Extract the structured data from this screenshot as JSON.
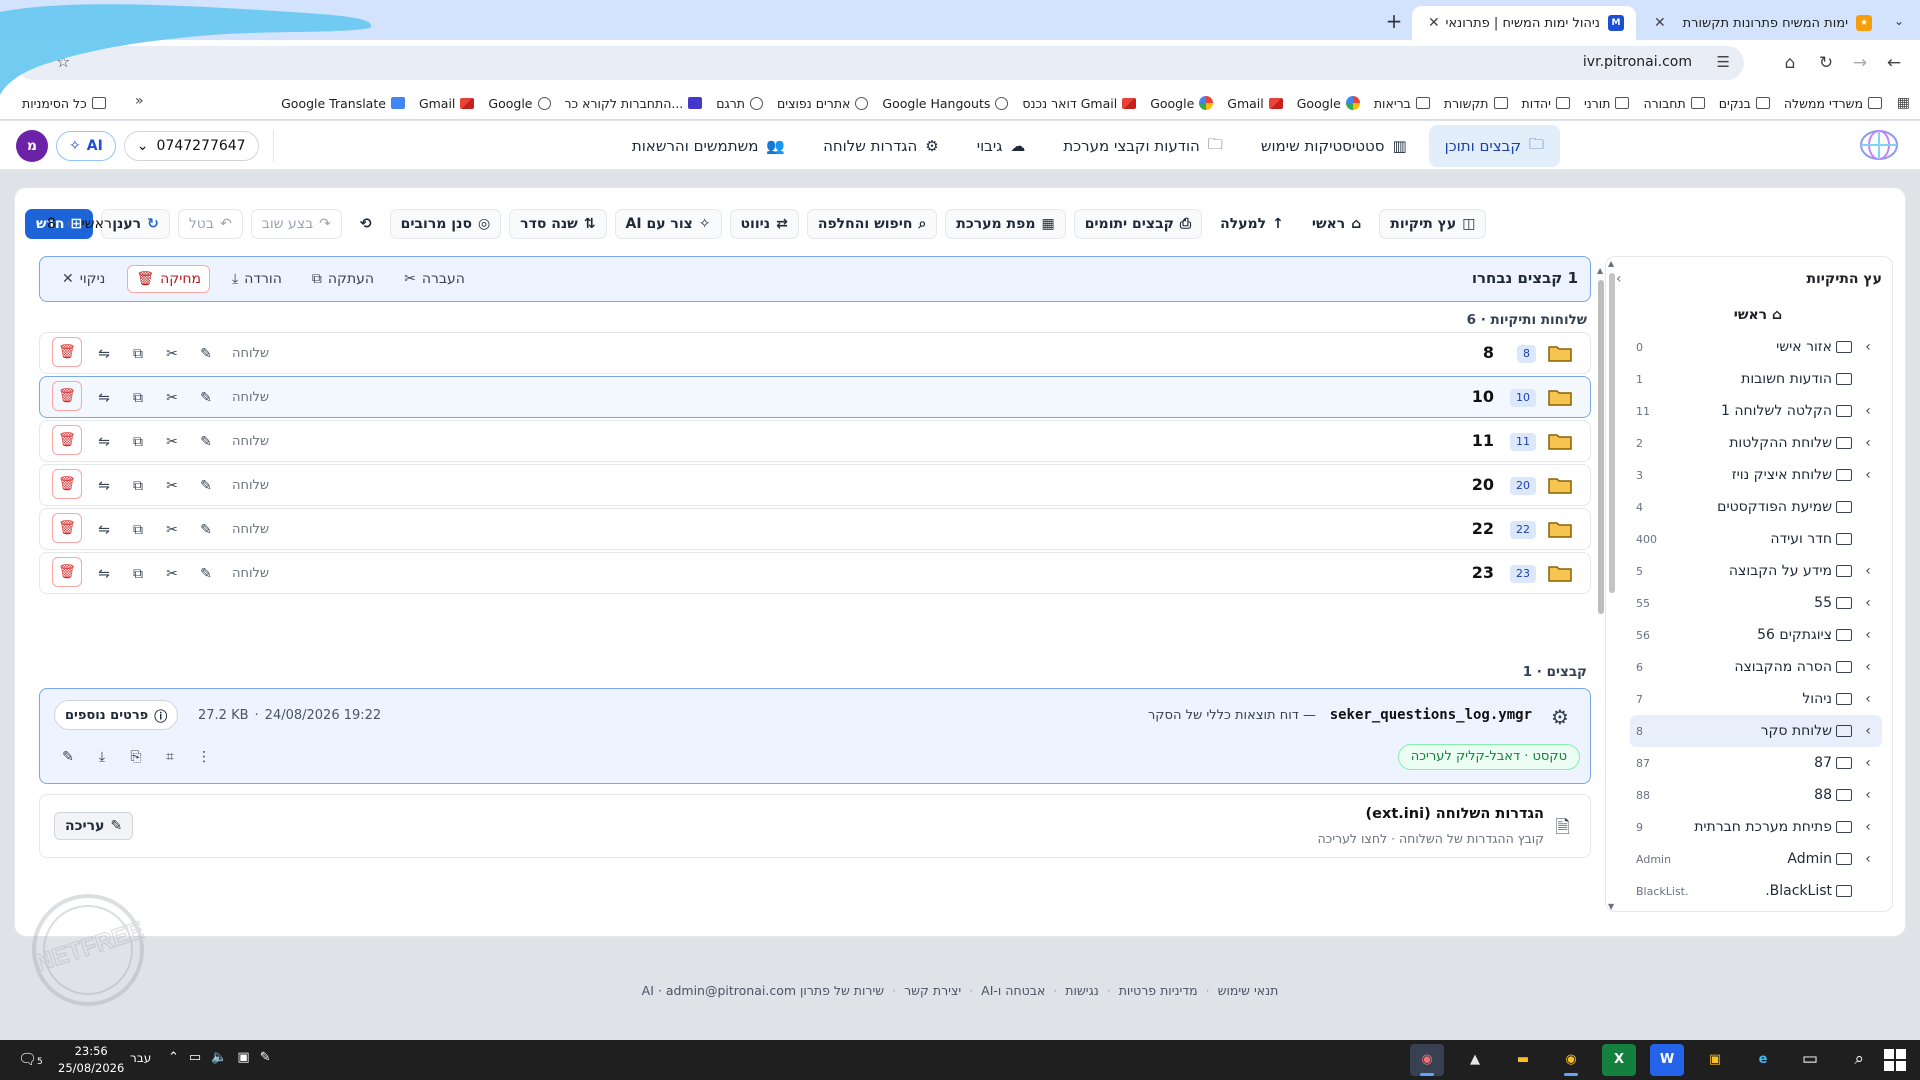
{
  "browser": {
    "tabs": [
      {
        "title": "ימות המשיח פתרונות תקשורת",
        "active": false
      },
      {
        "title": "ניהול ימות המשיח | פתרונאי",
        "active": true
      }
    ],
    "new_tab": "+",
    "url": "ivr.pitronai.com",
    "bookmarks": [
      {
        "label": "משרדי ממשלה",
        "icon": "folder-icon"
      },
      {
        "label": "בנקים",
        "icon": "folder-icon"
      },
      {
        "label": "תחבורה",
        "icon": "folder-icon"
      },
      {
        "label": "תורני",
        "icon": "folder-icon"
      },
      {
        "label": "יהדות",
        "icon": "folder-icon"
      },
      {
        "label": "תקשורת",
        "icon": "folder-icon"
      },
      {
        "label": "בריאות",
        "icon": "folder-icon"
      },
      {
        "label": "Google",
        "icon": "google-icon"
      },
      {
        "label": "Gmail",
        "icon": "gmail-icon"
      },
      {
        "label": "Google",
        "icon": "google-icon"
      },
      {
        "label": "דואר נכנס Gmail",
        "icon": "gmail-icon"
      },
      {
        "label": "Google Hangouts",
        "icon": "globe-icon"
      },
      {
        "label": "אתרים נפוצים",
        "icon": "shield-icon"
      },
      {
        "label": "תרגם",
        "icon": "globe-icon"
      },
      {
        "label": "התחברות לקורא כר...",
        "icon": "app-icon"
      },
      {
        "label": "Google",
        "icon": "globe-icon"
      },
      {
        "label": "Gmail",
        "icon": "gmail-icon"
      },
      {
        "label": "Google Translate",
        "icon": "translate-icon"
      }
    ],
    "all_bookmarks": "כל הסימניות",
    "more": "»"
  },
  "header": {
    "nav": [
      {
        "label": "קבצים ותוכן",
        "icon": "🗀",
        "active": true
      },
      {
        "label": "סטטיסטיקות שימוש",
        "icon": "▥",
        "active": false
      },
      {
        "label": "הודעות וקבצי מערכת",
        "icon": "🗀",
        "active": false
      },
      {
        "label": "גיבוי",
        "icon": "☁",
        "active": false
      },
      {
        "label": "הגדרות שלוחה",
        "icon": "⚙",
        "active": false
      },
      {
        "label": "משתמשים והרשאות",
        "icon": "👥",
        "active": false
      }
    ],
    "phone": "0747277647",
    "ai_label": "AI",
    "avatar_letter": "מ"
  },
  "toolbar": {
    "new": "חדש",
    "refresh": "רענן",
    "cancel": "בטל",
    "redo": "בצע שוב",
    "history_icon": "history-icon",
    "filter": "סנן מרובים",
    "sort": "שנה סדר",
    "ai_create": "צור עם AI",
    "navigate": "ניווט",
    "search_replace": "חיפוש והחלפה",
    "system_map": "מפת מערכת",
    "orphan_files": "קבצים יתומים",
    "up": "למעלה",
    "home": "ראשי",
    "folder_tree": "עץ תיקיות"
  },
  "breadcrumb": {
    "root": "ראשי",
    "current": "8"
  },
  "selection": {
    "count_label": "1 קבצים נבחרו",
    "move": "העברה",
    "copy": "העתקה",
    "download": "הורדה",
    "delete": "מחיקה",
    "clear": "ניקוי"
  },
  "folders_section": "שלוחות ותיקיות · 6",
  "folders": [
    {
      "name": "8",
      "badge": "8",
      "type": "שלוחה",
      "selected": false
    },
    {
      "name": "10",
      "badge": "10",
      "type": "שלוחה",
      "selected": true
    },
    {
      "name": "11",
      "badge": "11",
      "type": "שלוחה",
      "selected": false
    },
    {
      "name": "20",
      "badge": "20",
      "type": "שלוחה",
      "selected": false
    },
    {
      "name": "22",
      "badge": "22",
      "type": "שלוחה",
      "selected": false
    },
    {
      "name": "23",
      "badge": "23",
      "type": "שלוחה",
      "selected": false
    }
  ],
  "files_section": "קבצים · 1",
  "file": {
    "name": "seker_questions_log.ymgr",
    "description": "— דוח תוצאות כללי של הסקר",
    "tag": "טקסט · דאבל-קליק לעריכה",
    "size": "27.2 KB",
    "separator": "·",
    "datetime": "24/08/2026 19:22",
    "details": "פרטים נוספים"
  },
  "ini": {
    "title": "הגדרות השלוחה (ext.ini)",
    "subtitle": "קובץ ההגדרות של השלוחה · לחצו לעריכה",
    "edit": "עריכה"
  },
  "tree": {
    "title": "עץ התיקיות",
    "root": "⌂ ראשי",
    "items": [
      {
        "name": "אזור אישי",
        "count": "0",
        "expandable": true,
        "selected": false
      },
      {
        "name": "הודעות חשובות",
        "count": "1",
        "expandable": false,
        "selected": false
      },
      {
        "name": "הקלטה לשלוחה 1",
        "count": "11",
        "expandable": true,
        "selected": false
      },
      {
        "name": "שלוחת ההקלטות",
        "count": "2",
        "expandable": true,
        "selected": false
      },
      {
        "name": "שלוחת איציק נויז",
        "count": "3",
        "expandable": true,
        "selected": false
      },
      {
        "name": "שמיעת הפודקסטים",
        "count": "4",
        "expandable": false,
        "selected": false
      },
      {
        "name": "חדר ועידה",
        "count": "400",
        "expandable": false,
        "selected": false
      },
      {
        "name": "מידע על הקבוצה",
        "count": "5",
        "expandable": true,
        "selected": false
      },
      {
        "name": "55",
        "count": "55",
        "expandable": true,
        "selected": false
      },
      {
        "name": "ציוגתקים 56",
        "count": "56",
        "expandable": true,
        "selected": false
      },
      {
        "name": "הסרה מהקבוצה",
        "count": "6",
        "expandable": true,
        "selected": false
      },
      {
        "name": "ניהול",
        "count": "7",
        "expandable": true,
        "selected": false
      },
      {
        "name": "שלוחת סקר",
        "count": "8",
        "expandable": true,
        "selected": true
      },
      {
        "name": "87",
        "count": "87",
        "expandable": true,
        "selected": false
      },
      {
        "name": "88",
        "count": "88",
        "expandable": true,
        "selected": false
      },
      {
        "name": "פתיחת מערכת חברתית",
        "count": "9",
        "expandable": true,
        "selected": false
      },
      {
        "name": "Admin",
        "count": "Admin",
        "expandable": true,
        "selected": false
      },
      {
        "name": "BlackList.",
        "count": "BlackList.",
        "expandable": false,
        "selected": false
      }
    ]
  },
  "footer": {
    "links": [
      "תנאי שימוש",
      "מדיניות פרטיות",
      "נגישות",
      "אבטחה ו-AI",
      "יצירת קשר",
      "שירות של פתרון AI · admin@pitronai.com"
    ],
    "dot": "·"
  },
  "taskbar": {
    "time": "23:56",
    "date": "25/08/2026",
    "lang": "עבר",
    "notif_count": "5"
  },
  "watermark": "NETFREE מחשב מוגן",
  "colors": {
    "primary": "#1d64d8",
    "selection_border": "#7aa7e8",
    "danger": "#dc2626",
    "folder": "#f5b82e",
    "tag_green": "#15803d"
  }
}
